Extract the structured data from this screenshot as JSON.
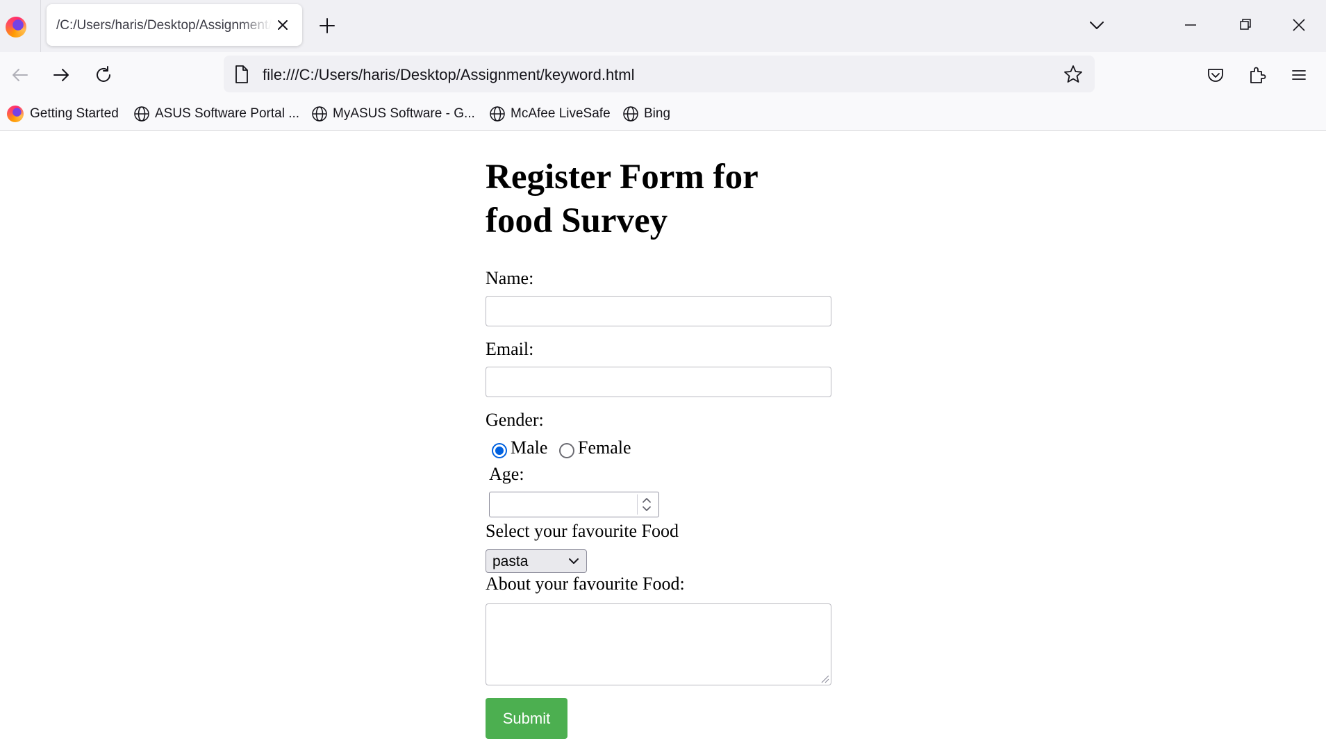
{
  "browser": {
    "tab": {
      "title": "/C:/Users/haris/Desktop/Assignment/keyword.html"
    },
    "url": "file:///C:/Users/haris/Desktop/Assignment/keyword.html",
    "bookmarks": [
      {
        "label": "Getting Started",
        "icon": "firefox-icon"
      },
      {
        "label": "ASUS Software Portal ...",
        "icon": "globe-icon"
      },
      {
        "label": "MyASUS Software - G...",
        "icon": "globe-icon"
      },
      {
        "label": "McAfee LiveSafe",
        "icon": "globe-icon"
      },
      {
        "label": "Bing",
        "icon": "globe-icon"
      }
    ]
  },
  "form": {
    "heading": "Register Form for food Survey",
    "name_label": "Name:",
    "name_value": "",
    "email_label": "Email:",
    "email_value": "",
    "gender_label": "Gender:",
    "gender_options": [
      {
        "label": "Male",
        "checked": true
      },
      {
        "label": "Female",
        "checked": false
      }
    ],
    "age_label": "Age:",
    "age_value": "",
    "food_label": "Select your favourite Food",
    "food_selected": "pasta",
    "about_label": "About your favourite Food:",
    "about_value": "",
    "submit_label": "Submit"
  },
  "colors": {
    "accent_radio": "#0061e0",
    "submit_bg": "#4caf50",
    "submit_text": "#ffffff",
    "chrome_bg": "#f0f0f4"
  }
}
